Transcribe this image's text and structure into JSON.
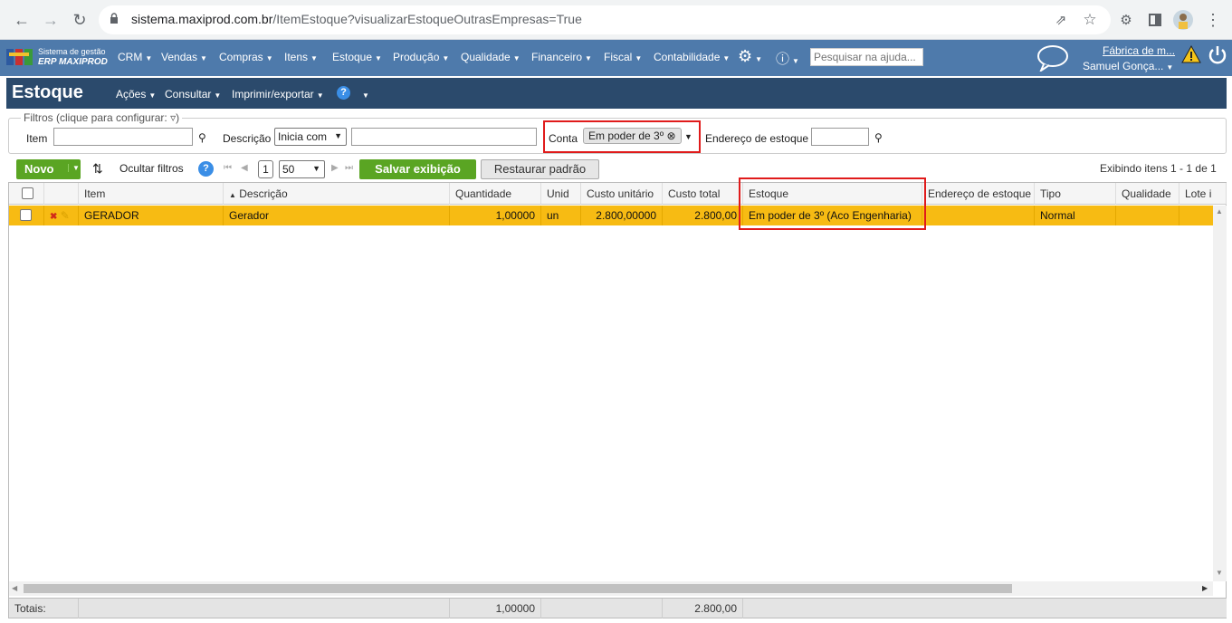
{
  "browser": {
    "url_host": "sistema.maxiprod.com.br",
    "url_path": "/ItemEstoque?visualizarEstoqueOutrasEmpresas=True"
  },
  "app": {
    "logo_line1": "Sistema de gestão",
    "logo_line2": "ERP MAXIPROD",
    "menu": [
      "CRM",
      "Vendas",
      "Compras",
      "Itens",
      "Estoque",
      "Produção",
      "Qualidade",
      "Financeiro",
      "Fiscal",
      "Contabilidade"
    ],
    "help_search_placeholder": "Pesquisar na ajuda...",
    "company": "Fábrica de m...",
    "user": "Samuel Gonça..."
  },
  "page": {
    "title": "Estoque",
    "menu": [
      "Ações",
      "Consultar",
      "Imprimir/exportar"
    ]
  },
  "filters": {
    "legend": "Filtros (clique para configurar:",
    "item_label": "Item",
    "descricao_label": "Descrição",
    "descricao_mode": "Inicia com",
    "conta_label": "Conta",
    "conta_value": "Em poder de 3º",
    "endereco_label": "Endereço de estoque"
  },
  "toolbar": {
    "novo": "Novo",
    "ocultar": "Ocultar filtros",
    "page": "1",
    "page_size": "50",
    "salvar": "Salvar exibição",
    "restaurar": "Restaurar padrão",
    "paging_info": "Exibindo itens 1 - 1 de 1"
  },
  "grid": {
    "columns": [
      "Item",
      "Descrição",
      "Quantidade",
      "Unid",
      "Custo unitário",
      "Custo total",
      "Estoque",
      "Endereço de estoque",
      "Tipo",
      "Qualidade",
      "Lote i"
    ],
    "rows": [
      {
        "item": "GERADOR",
        "descricao": "Gerador",
        "quantidade": "1,00000",
        "unid": "un",
        "custo_unitario": "2.800,00000",
        "custo_total": "2.800,00",
        "estoque": "Em poder de 3º (Aco Engenharia)",
        "endereco": "",
        "tipo": "Normal",
        "qualidade": ""
      }
    ],
    "totals_label": "Totais:",
    "total_quantidade": "1,00000",
    "total_custo": "2.800,00"
  }
}
